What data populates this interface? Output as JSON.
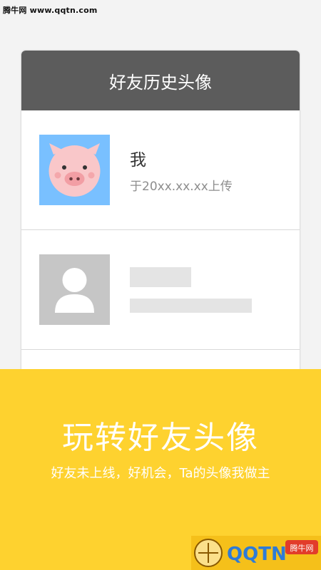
{
  "watermark": {
    "text": "腾牛网 www.qqtn.com"
  },
  "card": {
    "title": "好友历史头像",
    "rows": [
      {
        "avatar_icon": "pig-avatar-icon",
        "name": "我",
        "subtitle": "于20xx.xx.xx上传"
      },
      {
        "avatar_icon": "default-user-avatar-icon",
        "name": "",
        "subtitle": ""
      }
    ]
  },
  "banner": {
    "title": "玩转好友头像",
    "subtitle": "好友未上线，好机会，Ta的头像我做主"
  },
  "logo": {
    "text": "QQTN",
    "badge": "腾牛网"
  },
  "colors": {
    "header_bg": "#5c5c5c",
    "banner_bg": "#fed22f",
    "pig_avatar_bg": "#79c0ff",
    "default_avatar_bg": "#c6c6c6"
  }
}
